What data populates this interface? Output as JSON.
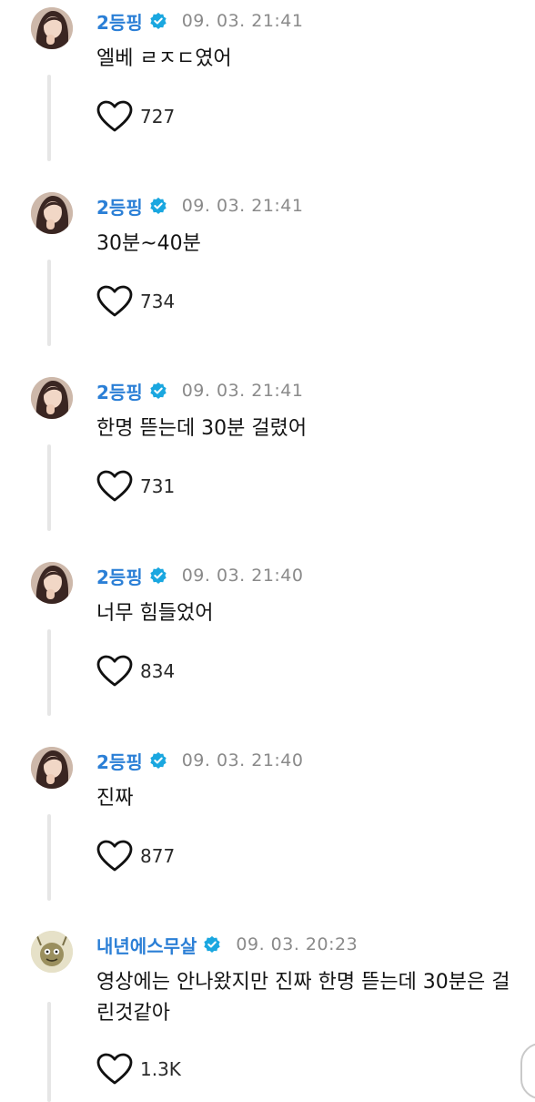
{
  "comments": [
    {
      "author": "2등핑",
      "time": "09. 03. 21:41",
      "text": "엘베 ㄹㅈㄷ였어",
      "likes": "727",
      "avatar_icon": "profile-photo-woman"
    },
    {
      "author": "2등핑",
      "time": "09. 03. 21:41",
      "text": "30분~40분",
      "likes": "734",
      "avatar_icon": "profile-photo-woman"
    },
    {
      "author": "2등핑",
      "time": "09. 03. 21:41",
      "text": "한명 뜯는데 30분 걸렸어",
      "likes": "731",
      "avatar_icon": "profile-photo-woman"
    },
    {
      "author": "2등핑",
      "time": "09. 03. 21:40",
      "text": "너무 힘들었어",
      "likes": "834",
      "avatar_icon": "profile-photo-woman"
    },
    {
      "author": "2등핑",
      "time": "09. 03. 21:40",
      "text": "진짜",
      "likes": "877",
      "avatar_icon": "profile-photo-woman"
    },
    {
      "author": "내년에스무살",
      "time": "09. 03. 20:23",
      "text": "영상에는 안나왔지만 진짜 한명 뜯는데 30분은 걸린것같아",
      "likes": "1.3K",
      "avatar_icon": "cartoon-character-avatar"
    }
  ],
  "colors": {
    "name": "#2b7fd6",
    "verified": "#1aa7e0",
    "time": "#8a8a8a",
    "thread_line": "#e6e6e6"
  }
}
